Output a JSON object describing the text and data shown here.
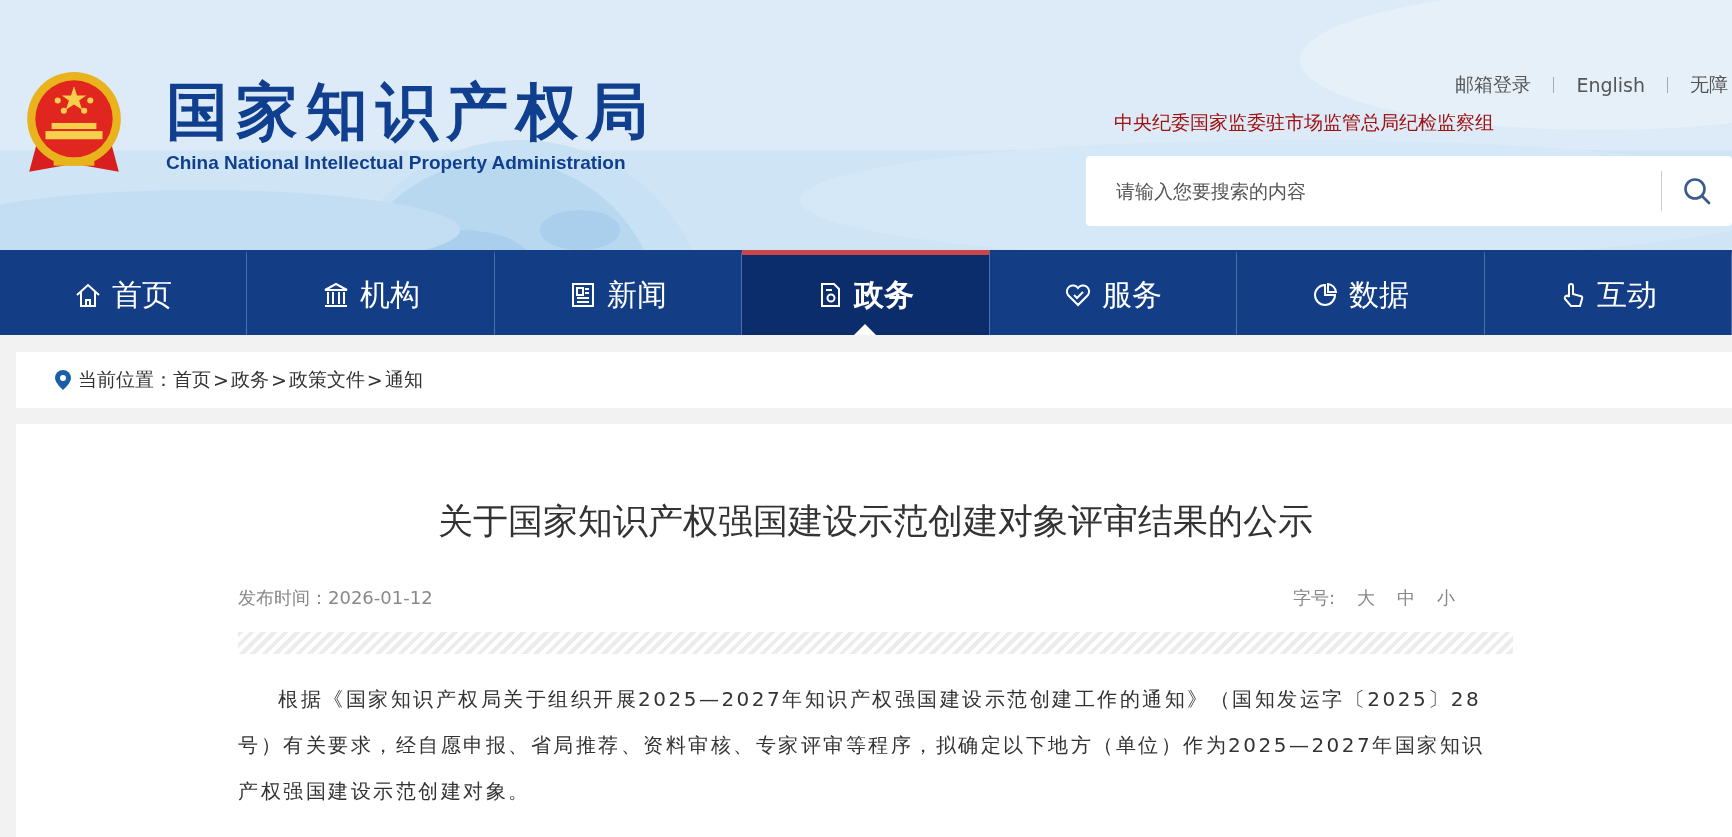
{
  "header": {
    "logo_title": "国家知识产权局",
    "logo_subtitle": "China National Intellectual Property Administration",
    "top_links": [
      "邮箱登录",
      "English",
      "无障"
    ],
    "notice": "中央纪委国家监委驻市场监管总局纪检监察组",
    "search": {
      "placeholder": "请输入您要搜索的内容"
    }
  },
  "nav": [
    {
      "label": "首页",
      "selected": false
    },
    {
      "label": "机构",
      "selected": false
    },
    {
      "label": "新闻",
      "selected": false
    },
    {
      "label": "政务",
      "selected": true
    },
    {
      "label": "服务",
      "selected": false
    },
    {
      "label": "数据",
      "selected": false
    },
    {
      "label": "互动",
      "selected": false
    }
  ],
  "breadcrumb": {
    "label": "当前位置：",
    "separator": ">",
    "path": [
      "首页",
      "政务",
      "政策文件",
      "通知"
    ]
  },
  "article": {
    "title": "关于国家知识产权强国建设示范创建对象评审结果的公示",
    "date": "发布时间：2026-01-12",
    "font_size_label": "字号:",
    "font_sizes": [
      "大",
      "中",
      "小"
    ],
    "paragraphs": [
      "根据《国家知识产权局关于组织开展2025—2027年知识产权强国建设示范创建工作的通知》（国知发运字〔2025〕28号）有关要求，经自愿申报、省局推荐、资料审核、专家评审等程序，拟确定以下地方（单位）作为2025—2027年国家知识产权强国建设示范创建对象。"
    ]
  }
}
